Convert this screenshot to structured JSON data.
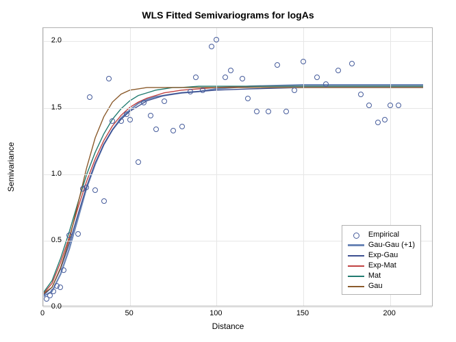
{
  "chart_data": {
    "type": "scatter",
    "title": "WLS Fitted Semivariograms for logAs",
    "xlabel": "Distance",
    "ylabel": "Semivariance",
    "xlim": [
      0,
      225
    ],
    "ylim": [
      0,
      2.1
    ],
    "xticks": [
      0,
      50,
      100,
      150,
      200
    ],
    "yticks": [
      0.0,
      0.5,
      1.0,
      1.5,
      2.0
    ],
    "empirical": {
      "name": "Empirical",
      "x": [
        2,
        4,
        6,
        8,
        10,
        12,
        15,
        20,
        23,
        25,
        27,
        30,
        35,
        38,
        40,
        45,
        48,
        50,
        55,
        58,
        62,
        65,
        70,
        75,
        80,
        85,
        88,
        92,
        97,
        100,
        105,
        108,
        115,
        118,
        123,
        130,
        135,
        140,
        145,
        150,
        158,
        163,
        170,
        178,
        183,
        188,
        193,
        197,
        200,
        205
      ],
      "y": [
        0.06,
        0.09,
        0.12,
        0.16,
        0.15,
        0.28,
        0.54,
        0.55,
        0.89,
        0.9,
        1.58,
        0.88,
        0.8,
        1.72,
        1.4,
        1.4,
        1.45,
        1.41,
        1.09,
        1.54,
        1.44,
        1.34,
        1.55,
        1.33,
        1.36,
        1.62,
        1.73,
        1.63,
        1.96,
        2.01,
        1.73,
        1.78,
        1.72,
        1.57,
        1.47,
        1.47,
        1.82,
        1.47,
        1.63,
        1.85,
        1.73,
        1.68,
        1.78,
        1.83,
        1.6,
        1.52,
        1.39,
        1.41,
        1.52,
        1.52
      ]
    },
    "series": [
      {
        "name": "Gau-Gau (+1)",
        "color": "#6a85b6",
        "x": [
          0,
          5,
          10,
          15,
          20,
          25,
          30,
          35,
          40,
          45,
          50,
          55,
          60,
          65,
          70,
          75,
          80,
          90,
          100,
          120,
          150,
          180,
          220
        ],
        "y": [
          0.07,
          0.11,
          0.24,
          0.43,
          0.66,
          0.89,
          1.07,
          1.22,
          1.33,
          1.42,
          1.48,
          1.53,
          1.56,
          1.58,
          1.59,
          1.6,
          1.61,
          1.62,
          1.64,
          1.66,
          1.67,
          1.67,
          1.67
        ]
      },
      {
        "name": "Exp-Gau",
        "color": "#3a4d8f",
        "x": [
          0,
          5,
          10,
          15,
          20,
          25,
          30,
          35,
          40,
          45,
          50,
          55,
          60,
          65,
          70,
          75,
          80,
          90,
          100,
          120,
          150,
          180,
          220
        ],
        "y": [
          0.08,
          0.14,
          0.28,
          0.47,
          0.69,
          0.9,
          1.08,
          1.22,
          1.33,
          1.41,
          1.47,
          1.51,
          1.55,
          1.57,
          1.59,
          1.6,
          1.61,
          1.62,
          1.63,
          1.64,
          1.65,
          1.65,
          1.65
        ]
      },
      {
        "name": "Exp-Mat",
        "color": "#c04040",
        "x": [
          0,
          5,
          10,
          15,
          20,
          25,
          30,
          35,
          40,
          45,
          50,
          55,
          60,
          65,
          70,
          75,
          80,
          90,
          100,
          120,
          150,
          180,
          220
        ],
        "y": [
          0.09,
          0.17,
          0.33,
          0.52,
          0.74,
          0.94,
          1.11,
          1.25,
          1.36,
          1.44,
          1.5,
          1.54,
          1.57,
          1.59,
          1.61,
          1.62,
          1.63,
          1.64,
          1.65,
          1.66,
          1.66,
          1.66,
          1.66
        ]
      },
      {
        "name": "Mat",
        "color": "#1f7a6f",
        "x": [
          0,
          5,
          10,
          15,
          20,
          25,
          30,
          35,
          40,
          45,
          50,
          55,
          60,
          65,
          70,
          75,
          80,
          90,
          100,
          120,
          150,
          180,
          220
        ],
        "y": [
          0.1,
          0.19,
          0.36,
          0.56,
          0.78,
          0.99,
          1.16,
          1.3,
          1.41,
          1.49,
          1.55,
          1.59,
          1.61,
          1.63,
          1.64,
          1.65,
          1.65,
          1.66,
          1.66,
          1.66,
          1.66,
          1.66,
          1.66
        ]
      },
      {
        "name": "Gau",
        "color": "#8a5a2b",
        "x": [
          0,
          5,
          10,
          15,
          20,
          25,
          30,
          35,
          40,
          45,
          50,
          55,
          60,
          65,
          70,
          75,
          80,
          90,
          100,
          120,
          150,
          180,
          220
        ],
        "y": [
          0.09,
          0.14,
          0.29,
          0.5,
          0.77,
          1.04,
          1.27,
          1.43,
          1.54,
          1.6,
          1.63,
          1.64,
          1.65,
          1.65,
          1.65,
          1.65,
          1.65,
          1.65,
          1.65,
          1.65,
          1.65,
          1.65,
          1.65
        ]
      }
    ],
    "legend": {
      "position": "bottom-right",
      "entries": [
        "Empirical",
        "Gau-Gau (+1)",
        "Exp-Gau",
        "Exp-Mat",
        "Mat",
        "Gau"
      ]
    }
  }
}
